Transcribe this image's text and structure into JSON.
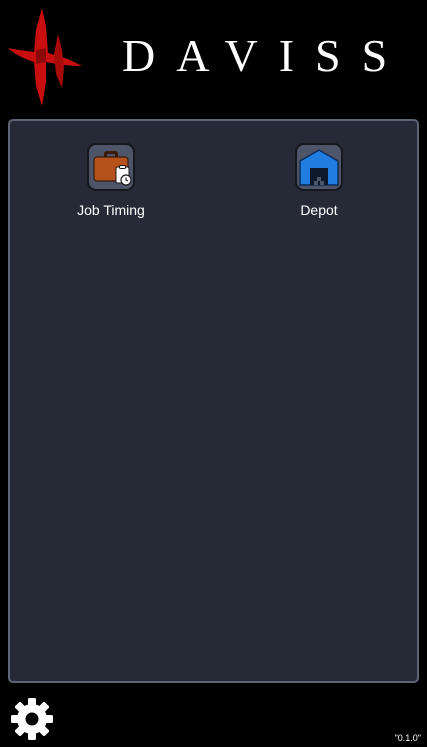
{
  "header": {
    "brand_name": "DAVISS",
    "brand_color": "#cc1010"
  },
  "apps": [
    {
      "label": "Job Timing",
      "icon": "briefcase-clipboard-clock-icon"
    },
    {
      "label": "Depot",
      "icon": "warehouse-icon"
    }
  ],
  "footer": {
    "settings_icon": "gear-icon",
    "version": "\"0.1.0\""
  },
  "colors": {
    "background": "#000000",
    "panel": "#262a37",
    "panel_border": "#5d6576",
    "tile_bg": "#4e5568",
    "job_icon": "#b5521b",
    "depot_icon": "#1f7ee0"
  }
}
